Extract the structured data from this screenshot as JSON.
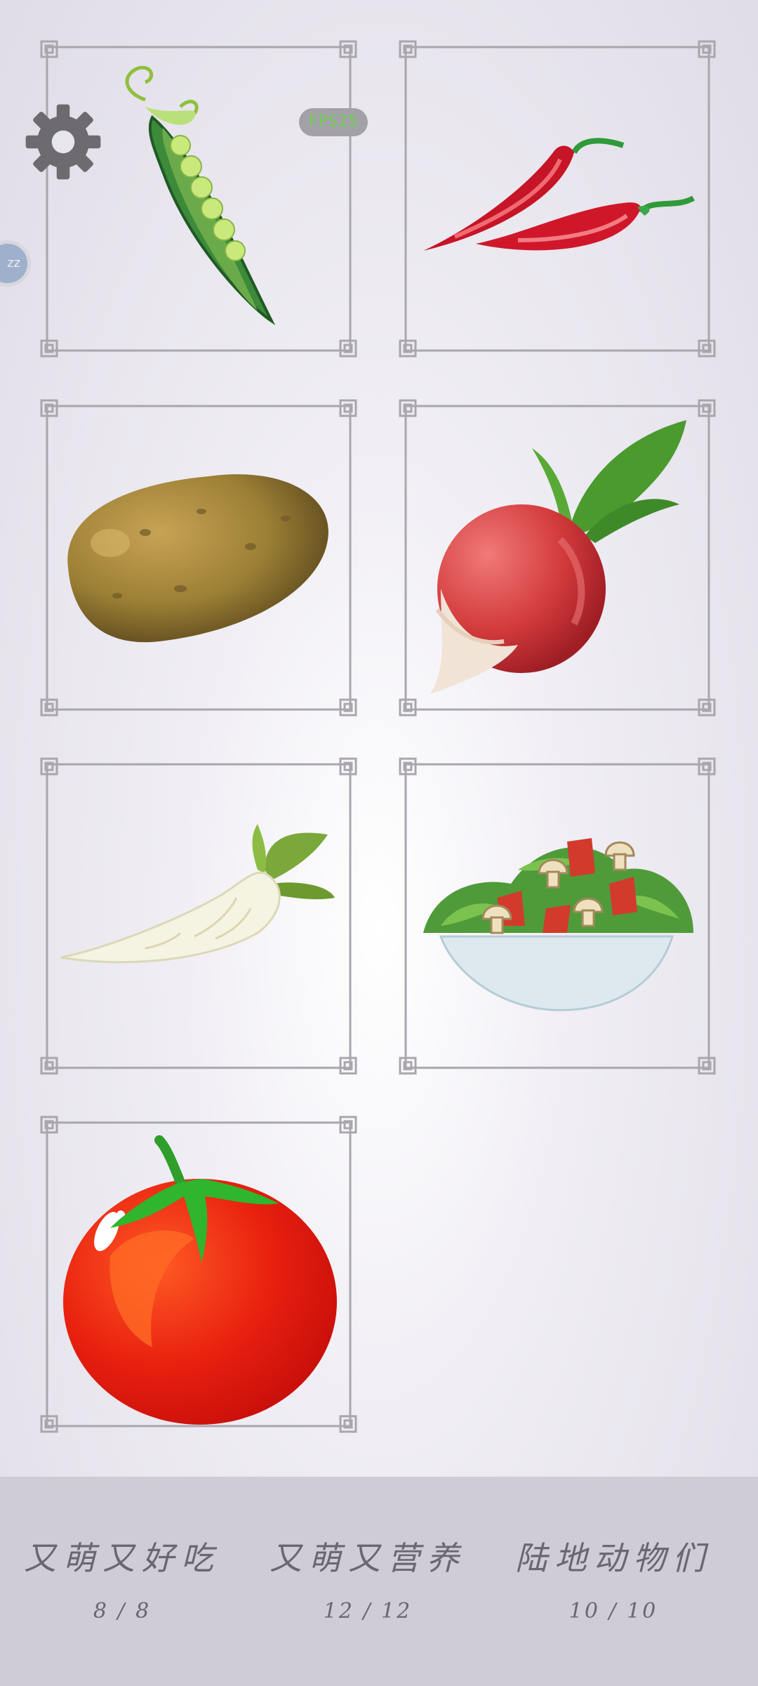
{
  "cards": [
    {
      "name": "pea-pod",
      "icon": "pea-pod-icon"
    },
    {
      "name": "red-chili-peppers",
      "icon": "chili-pepper-icon"
    },
    {
      "name": "potato",
      "icon": "potato-icon"
    },
    {
      "name": "radish",
      "icon": "radish-icon"
    },
    {
      "name": "white-radish",
      "icon": "daikon-icon"
    },
    {
      "name": "salad-bowl",
      "icon": "salad-icon"
    },
    {
      "name": "tomato",
      "icon": "tomato-icon"
    }
  ],
  "overlay": {
    "settings_icon": "gear-icon",
    "pill_text": "FPS25",
    "side_bubble_text": "zz"
  },
  "albums": [
    {
      "title": "又萌又好吃",
      "progress": "8 / 8"
    },
    {
      "title": "又萌又营养",
      "progress": "12 / 12"
    },
    {
      "title": "陆地动物们",
      "progress": "10 / 10"
    }
  ],
  "colors": {
    "frame": "#a9a6ae",
    "bottom_bar": "#d0ccd6",
    "text": "#6a6770"
  }
}
